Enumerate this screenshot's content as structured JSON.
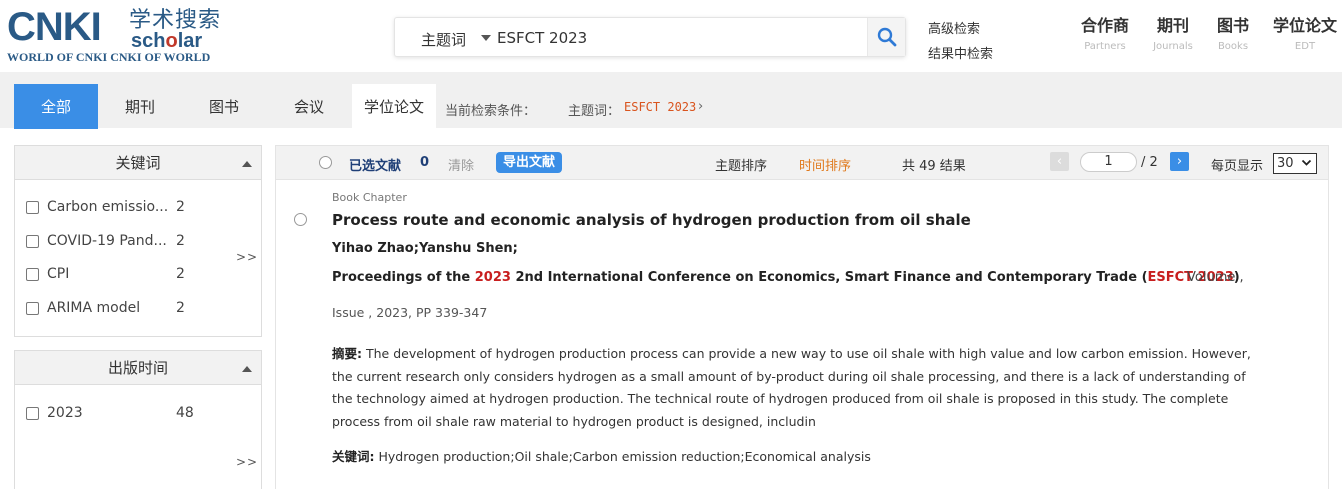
{
  "logo": {
    "main": "CNKI",
    "cn": "学术搜索",
    "scholar_pre": "sch",
    "scholar_o": "o",
    "scholar_post": "lar",
    "tagline": "WORLD OF CNKI CNKI OF WORLD"
  },
  "search": {
    "field": "主题词",
    "query": "ESFCT 2023"
  },
  "header_links": {
    "advanced": "高级检索",
    "within": "结果中检索"
  },
  "nav": [
    {
      "label": "合作商",
      "sub": "Partners"
    },
    {
      "label": "期刊",
      "sub": "Journals"
    },
    {
      "label": "图书",
      "sub": "Books"
    },
    {
      "label": "学位论文",
      "sub": "EDT"
    }
  ],
  "tabs": [
    "全部",
    "期刊",
    "图书",
    "会议",
    "学位论文"
  ],
  "condition": {
    "label": "当前检索条件：",
    "field": "主题词：",
    "value": "ESFCT 2023",
    "arrow": "›"
  },
  "facets": {
    "keywords": {
      "title": "关键词",
      "items": [
        {
          "label": "Carbon emissio...",
          "count": "2"
        },
        {
          "label": "COVID-19 Pand...",
          "count": "2"
        },
        {
          "label": "CPI",
          "count": "2"
        },
        {
          "label": "ARIMA model",
          "count": "2"
        }
      ],
      "more": ">>"
    },
    "year": {
      "title": "出版时间",
      "items": [
        {
          "label": "2023",
          "count": "48"
        }
      ],
      "more": ">>"
    }
  },
  "toolbar": {
    "selected_label": "已选文献",
    "selected_count": "0",
    "clear": "清除",
    "export": "导出文献",
    "sort_topic": "主题排序",
    "sort_time": "时间排序",
    "total": "共 49 结果",
    "prev": "‹",
    "page": "1",
    "pages": "/ 2",
    "next": "›",
    "per_page_label": "每页显示",
    "per_page": "30"
  },
  "result": {
    "type": "Book Chapter",
    "title": "Process route and economic analysis of hydrogen production from oil shale",
    "authors": "Yihao Zhao;Yanshu Shen;",
    "source_pre": "Proceedings of the ",
    "source_hl1": "2023",
    "source_mid": " 2nd International Conference on Economics, Smart Finance and Contemporary Trade (",
    "source_hl2": "ESFCT 2023",
    "source_post": ")",
    "volume": "Volume ,",
    "issue": "Issue , 2023, PP 339-347",
    "abstract_label": "摘要:",
    "abstract": " The development of hydrogen production process can provide a new way to use oil shale with high value and low carbon emission. However, the current research only considers hydrogen as a small amount of by-product during oil shale processing, and there is a lack of understanding of the technology aimed at hydrogen production. The technical route of hydrogen produced from oil shale is proposed in this study. The complete process from oil shale raw material to hydrogen product is designed, includin",
    "keywords_label": "关键词:",
    "keywords": " Hydrogen production;Oil shale;Carbon emission reduction;Economical analysis"
  },
  "colors": {
    "accent": "#3a8ee6",
    "brand": "#2a5a86",
    "highlight": "#c81e1e",
    "sort_active": "#e07a1e"
  }
}
